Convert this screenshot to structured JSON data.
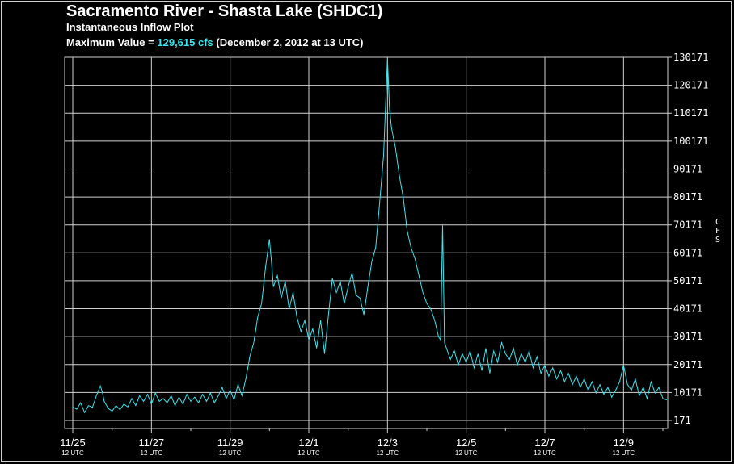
{
  "chart_data": {
    "type": "line",
    "title": "Sacramento River - Shasta Lake (SHDC1)",
    "subtitle": "Instantaneous Inflow Plot",
    "max_prefix": "Maximum Value =",
    "max_value_text": "129,615 cfs",
    "max_suffix": "(December 2, 2012 at 13 UTC)",
    "ylabel": "CFS",
    "y_ticks": [
      171,
      10171,
      20171,
      30171,
      40171,
      50171,
      60171,
      70171,
      80171,
      90171,
      100171,
      110171,
      120171,
      130171
    ],
    "ylim": [
      171,
      130171
    ],
    "x_tick_labels": [
      "11/25",
      "11/27",
      "11/29",
      "12/1",
      "12/3",
      "12/5",
      "12/7",
      "12/9"
    ],
    "x_tick_sublabel": "12 UTC",
    "x_tick_days": [
      0,
      2,
      4,
      6,
      8,
      10,
      12,
      14
    ],
    "xlim_days": [
      -0.05,
      15.2
    ],
    "grid": true,
    "series": [
      {
        "color": "#37e6ee",
        "points": [
          [
            0.0,
            5000
          ],
          [
            0.1,
            4200
          ],
          [
            0.2,
            6500
          ],
          [
            0.3,
            3000
          ],
          [
            0.4,
            5500
          ],
          [
            0.5,
            4800
          ],
          [
            0.6,
            9000
          ],
          [
            0.7,
            12500
          ],
          [
            0.75,
            10500
          ],
          [
            0.8,
            7000
          ],
          [
            0.9,
            4500
          ],
          [
            1.0,
            3500
          ],
          [
            1.1,
            5500
          ],
          [
            1.2,
            4000
          ],
          [
            1.3,
            6000
          ],
          [
            1.4,
            5000
          ],
          [
            1.5,
            8000
          ],
          [
            1.6,
            5500
          ],
          [
            1.7,
            9000
          ],
          [
            1.8,
            7000
          ],
          [
            1.9,
            9500
          ],
          [
            2.0,
            6000
          ],
          [
            2.1,
            10000
          ],
          [
            2.2,
            7000
          ],
          [
            2.3,
            8000
          ],
          [
            2.4,
            6500
          ],
          [
            2.5,
            9000
          ],
          [
            2.6,
            5500
          ],
          [
            2.7,
            8500
          ],
          [
            2.8,
            6000
          ],
          [
            2.9,
            9500
          ],
          [
            3.0,
            7000
          ],
          [
            3.1,
            8500
          ],
          [
            3.2,
            6500
          ],
          [
            3.3,
            9500
          ],
          [
            3.4,
            7000
          ],
          [
            3.5,
            10000
          ],
          [
            3.6,
            6500
          ],
          [
            3.7,
            9000
          ],
          [
            3.8,
            12000
          ],
          [
            3.9,
            8000
          ],
          [
            4.0,
            11000
          ],
          [
            4.1,
            7500
          ],
          [
            4.2,
            13000
          ],
          [
            4.3,
            9000
          ],
          [
            4.4,
            15000
          ],
          [
            4.5,
            23000
          ],
          [
            4.6,
            28000
          ],
          [
            4.7,
            37000
          ],
          [
            4.8,
            42000
          ],
          [
            4.9,
            55000
          ],
          [
            5.0,
            65000
          ],
          [
            5.05,
            57000
          ],
          [
            5.1,
            48000
          ],
          [
            5.2,
            52000
          ],
          [
            5.3,
            44000
          ],
          [
            5.4,
            50000
          ],
          [
            5.5,
            40000
          ],
          [
            5.6,
            46000
          ],
          [
            5.7,
            37000
          ],
          [
            5.8,
            32000
          ],
          [
            5.9,
            36000
          ],
          [
            6.0,
            29000
          ],
          [
            6.1,
            33000
          ],
          [
            6.2,
            26000
          ],
          [
            6.3,
            36000
          ],
          [
            6.4,
            24000
          ],
          [
            6.5,
            38000
          ],
          [
            6.6,
            51000
          ],
          [
            6.7,
            46000
          ],
          [
            6.8,
            50000
          ],
          [
            6.9,
            42000
          ],
          [
            7.0,
            48000
          ],
          [
            7.1,
            53000
          ],
          [
            7.2,
            45000
          ],
          [
            7.3,
            44000
          ],
          [
            7.4,
            38000
          ],
          [
            7.5,
            48000
          ],
          [
            7.6,
            57000
          ],
          [
            7.7,
            62000
          ],
          [
            7.8,
            78000
          ],
          [
            7.9,
            95000
          ],
          [
            8.0,
            129615
          ],
          [
            8.05,
            112000
          ],
          [
            8.1,
            105000
          ],
          [
            8.2,
            98000
          ],
          [
            8.3,
            88000
          ],
          [
            8.4,
            80000
          ],
          [
            8.5,
            68000
          ],
          [
            8.6,
            62000
          ],
          [
            8.7,
            58000
          ],
          [
            8.8,
            52000
          ],
          [
            8.9,
            46000
          ],
          [
            9.0,
            42000
          ],
          [
            9.1,
            40000
          ],
          [
            9.2,
            36000
          ],
          [
            9.3,
            30000
          ],
          [
            9.35,
            29000
          ],
          [
            9.4,
            70000
          ],
          [
            9.45,
            28000
          ],
          [
            9.5,
            26000
          ],
          [
            9.6,
            22000
          ],
          [
            9.7,
            25000
          ],
          [
            9.8,
            20000
          ],
          [
            9.9,
            24000
          ],
          [
            10.0,
            21000
          ],
          [
            10.1,
            25000
          ],
          [
            10.2,
            19000
          ],
          [
            10.3,
            24000
          ],
          [
            10.4,
            18000
          ],
          [
            10.5,
            26000
          ],
          [
            10.6,
            17000
          ],
          [
            10.7,
            25000
          ],
          [
            10.8,
            21000
          ],
          [
            10.9,
            28000
          ],
          [
            11.0,
            24000
          ],
          [
            11.1,
            22000
          ],
          [
            11.2,
            26000
          ],
          [
            11.3,
            20000
          ],
          [
            11.4,
            24000
          ],
          [
            11.5,
            21000
          ],
          [
            11.6,
            25000
          ],
          [
            11.7,
            19000
          ],
          [
            11.8,
            23000
          ],
          [
            11.9,
            17000
          ],
          [
            12.0,
            20000
          ],
          [
            12.1,
            16000
          ],
          [
            12.2,
            19000
          ],
          [
            12.3,
            15000
          ],
          [
            12.4,
            18000
          ],
          [
            12.5,
            14000
          ],
          [
            12.6,
            17000
          ],
          [
            12.7,
            13000
          ],
          [
            12.8,
            16000
          ],
          [
            12.9,
            12000
          ],
          [
            13.0,
            15000
          ],
          [
            13.1,
            11000
          ],
          [
            13.2,
            14000
          ],
          [
            13.3,
            10000
          ],
          [
            13.4,
            13000
          ],
          [
            13.5,
            9500
          ],
          [
            13.6,
            12000
          ],
          [
            13.7,
            8500
          ],
          [
            13.8,
            11000
          ],
          [
            13.9,
            14000
          ],
          [
            14.0,
            20000
          ],
          [
            14.1,
            13000
          ],
          [
            14.2,
            11000
          ],
          [
            14.3,
            15000
          ],
          [
            14.4,
            9000
          ],
          [
            14.5,
            12000
          ],
          [
            14.6,
            8000
          ],
          [
            14.7,
            14000
          ],
          [
            14.8,
            10000
          ],
          [
            14.9,
            12000
          ],
          [
            15.0,
            8000
          ],
          [
            15.1,
            7500
          ]
        ]
      }
    ]
  }
}
